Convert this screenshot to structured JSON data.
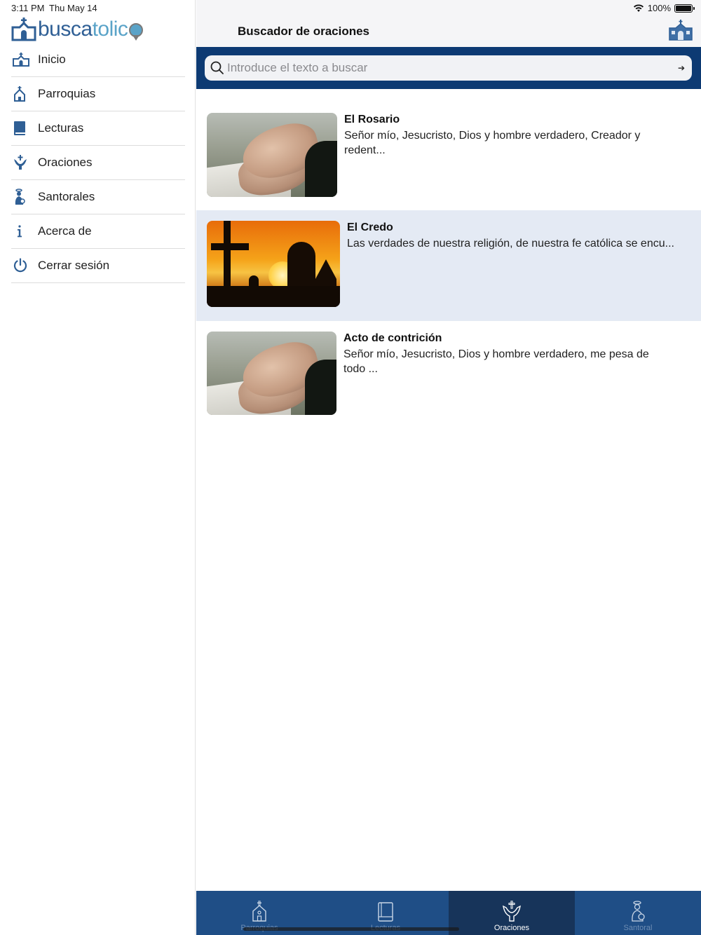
{
  "status": {
    "time": "3:11 PM",
    "date": "Thu May 14",
    "battery": "100%"
  },
  "logo": {
    "part1": "busca",
    "part2": "tolic"
  },
  "sidebar": {
    "items": [
      {
        "label": "Inicio",
        "icon": "church-icon"
      },
      {
        "label": "Parroquias",
        "icon": "parish-icon"
      },
      {
        "label": "Lecturas",
        "icon": "book-icon"
      },
      {
        "label": "Oraciones",
        "icon": "praying-hands-icon"
      },
      {
        "label": "Santorales",
        "icon": "saint-icon"
      },
      {
        "label": "Acerca de",
        "icon": "info-icon"
      },
      {
        "label": "Cerrar sesión",
        "icon": "power-icon"
      }
    ]
  },
  "header": {
    "title": "Buscador de oraciones"
  },
  "search": {
    "placeholder": "Introduce el texto a buscar",
    "value": ""
  },
  "prayers": [
    {
      "title": "El Rosario",
      "description": "Señor mío, Jesucristo, Dios y hombre verdadero, Creador y redent...",
      "image": "praying-hands-photo"
    },
    {
      "title": "El Credo",
      "description": "Las verdades de nuestra religión, de nuestra fe católica se encu...",
      "image": "cross-sunset-photo",
      "selected": true
    },
    {
      "title": "Acto de contrición",
      "description": "Señor mío, Jesucristo, Dios y hombre verdadero, me pesa de todo ...",
      "image": "praying-hands-photo"
    }
  ],
  "tabbar": {
    "tabs": [
      {
        "label": "Parroquias",
        "icon": "parish-icon"
      },
      {
        "label": "Lecturas",
        "icon": "book-icon"
      },
      {
        "label": "Oraciones",
        "icon": "praying-hands-icon",
        "active": true
      },
      {
        "label": "Santoral",
        "icon": "saint-icon"
      }
    ]
  },
  "colors": {
    "brand": "#0d3a73",
    "tabbar": "#1f4e86",
    "tab_active": "#17345a",
    "selected_row": "#e4eaf4"
  }
}
